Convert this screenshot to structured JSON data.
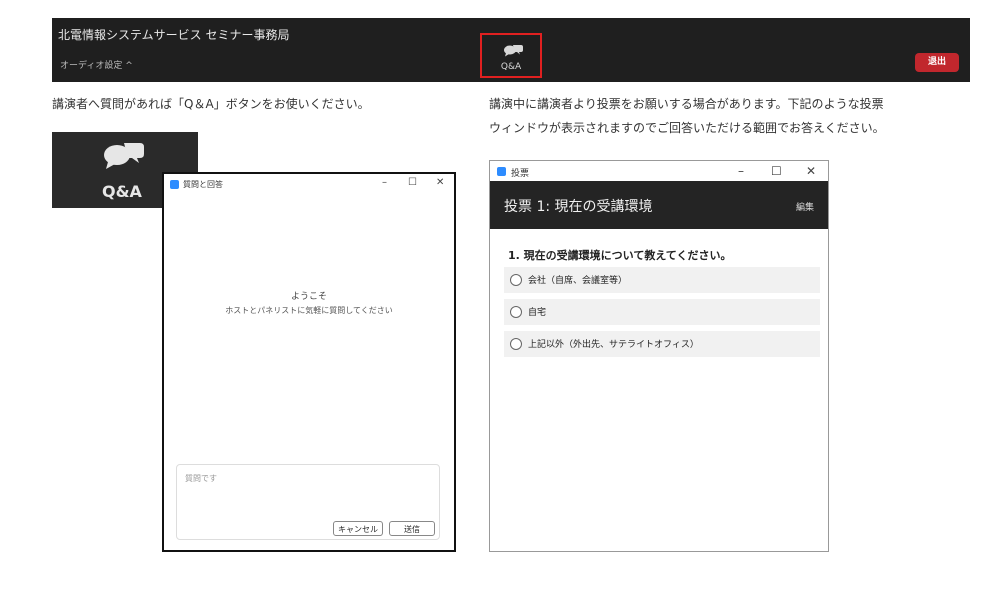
{
  "toolbar": {
    "title": "北電情報システムサービス セミナー事務局",
    "audio_settings": "オーディオ設定 ^",
    "qa_label": "Q&A",
    "leave_label": "退出"
  },
  "captions": {
    "left": "講演者へ質問があれば「Q＆A」ボタンをお使いください。",
    "right_line1": "講演中に講演者より投票をお願いする場合があります。下記のような投票",
    "right_line2": "ウィンドウが表示されますのでご回答いただける範囲でお答えください。"
  },
  "big_qa_icon": {
    "label": "Q&A"
  },
  "qa_dialog": {
    "title": "質問と回答",
    "min": "–",
    "max": "☐",
    "close": "✕",
    "welcome": "ようこそ",
    "hint": "ホストとパネリストに気軽に質問してください",
    "input_placeholder": "質問です",
    "cancel_label": "キャンセル",
    "send_label": "送信"
  },
  "poll_dialog": {
    "window_title": "投票",
    "min": "–",
    "max": "☐",
    "close": "✕",
    "poll_title": "投票 1: 現在の受講環境",
    "edit_label": "編集",
    "question": "1. 現在の受講環境について教えてください。",
    "options": [
      "会社（自席、会議室等）",
      "自宅",
      "上記以外（外出先、サテライトオフィス）"
    ]
  },
  "colors": {
    "accent_red": "#c1272d",
    "highlight_border": "#e02020",
    "app_blue": "#2d8cff",
    "dark_bg": "#1f1f1f"
  }
}
